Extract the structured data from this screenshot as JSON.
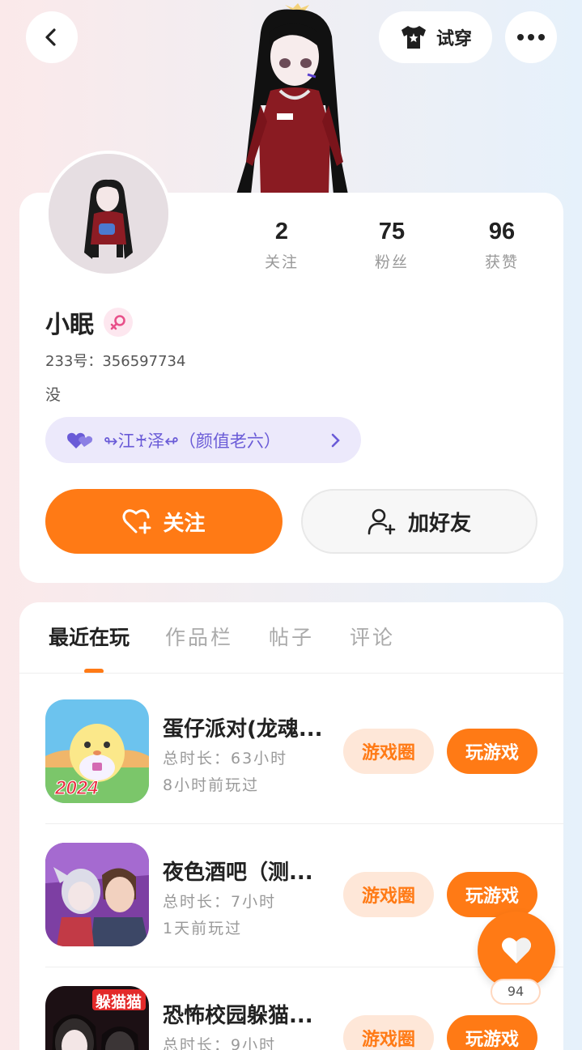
{
  "header": {
    "try_on_label": "试穿",
    "icons": {
      "back": "chevron-left-icon",
      "tshirt": "tshirt-icon",
      "more": "more-dots-icon"
    }
  },
  "profile": {
    "name": "小眠",
    "gender_icon": "female-icon",
    "uid": "233号：356597734",
    "bio": "没",
    "stats": [
      {
        "value": "2",
        "label": "关注"
      },
      {
        "value": "75",
        "label": "粉丝"
      },
      {
        "value": "96",
        "label": "获赞"
      }
    ],
    "relation": {
      "text": "↬江♰泽↫（颜值老六）",
      "icon": "double-heart-icon"
    },
    "follow_label": "关注",
    "add_friend_label": "加好友"
  },
  "tabs": [
    {
      "label": "最近在玩",
      "active": true
    },
    {
      "label": "作品栏",
      "active": false
    },
    {
      "label": "帖子",
      "active": false
    },
    {
      "label": "评论",
      "active": false
    }
  ],
  "games": [
    {
      "title": "蛋仔派对(龙魂...",
      "total": "总时长：63小时",
      "last": "8小时前玩过",
      "circle_label": "游戏圈",
      "play_label": "玩游戏",
      "icon_year": "2024"
    },
    {
      "title": "夜色酒吧（测...",
      "total": "总时长：7小时",
      "last": "1天前玩过",
      "circle_label": "游戏圈",
      "play_label": "玩游戏"
    },
    {
      "title": "恐怖校园躲猫...",
      "total": "总时长：9小时",
      "last": "",
      "circle_label": "游戏圈",
      "play_label": "玩游戏",
      "icon_text": "躲猫猫"
    }
  ],
  "like_fab": {
    "count": "94",
    "icon": "heart-icon"
  },
  "colors": {
    "accent": "#ff7a15",
    "relation_bg": "#ece9fb",
    "relation_text": "#6a5bd7",
    "gender_pink": "#e8508a"
  }
}
